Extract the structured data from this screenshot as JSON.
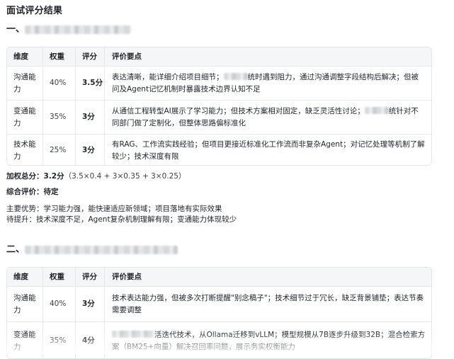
{
  "title": "面试评分结果",
  "section1": {
    "prefix": "一、",
    "table": {
      "headers": [
        "维度",
        "权重",
        "评分",
        "评价要点"
      ],
      "rows": [
        {
          "dim": "沟通能力",
          "weight": "40%",
          "score": "3.5分",
          "comment_a": "表达清晰，能详细介绍项目细节；",
          "comment_b": "统时遇到阻力，通过沟通调整字段结构后解决；但被问及Agent记忆机制时暴露技术边界认知不足"
        },
        {
          "dim": "变通能力",
          "weight": "35%",
          "score": "3分",
          "comment_a": "从通信工程转型AI展示了学习能力；但技术方案相对固定，缺乏灵活性讨论；",
          "comment_b": "统针对不同部门做了定制化，但整体思路偏标准化"
        },
        {
          "dim": "技术能力",
          "weight": "25%",
          "score": "3分",
          "comment_a": "有RAG、工作流实践经验；但项目更接近标准化工作流而非复杂Agent；对记忆处理等机制了解较少；技术深度有限",
          "comment_b": ""
        }
      ]
    },
    "weighted_label": "加权总分：",
    "weighted_value": "3.2分",
    "weighted_formula": "（3.5×0.4 + 3×0.35 + 3×0.25）",
    "overall_label": "综合评价：",
    "overall_value": "待定",
    "strengths": "主要优势：学习能力强，能快速适应新领域；项目落地有实际效果",
    "improve": "待提升：技术深度不足，Agent复杂机制理解有限；变通能力体现较少"
  },
  "section2": {
    "prefix": "二、",
    "table": {
      "headers": [
        "维度",
        "权重",
        "评分",
        "评价要点"
      ],
      "rows": [
        {
          "dim": "沟通能力",
          "weight": "40%",
          "score": "3分",
          "comment_a": "技术表达能力强，但被多次打断提醒\"别念稿子\"；技术细节过于冗长，缺乏背景铺垫；表达节奏需要调整",
          "comment_b": ""
        },
        {
          "dim": "变通能力",
          "weight": "35%",
          "score": "4分",
          "comment_a": "活迭代技术，从Ollama迁移到vLLM；模型规模从7B逐步升级到32B；混合检索方案（BM25+向量）解决召回率问题，展示务实权衡能力",
          "comment_b": ""
        }
      ]
    }
  }
}
